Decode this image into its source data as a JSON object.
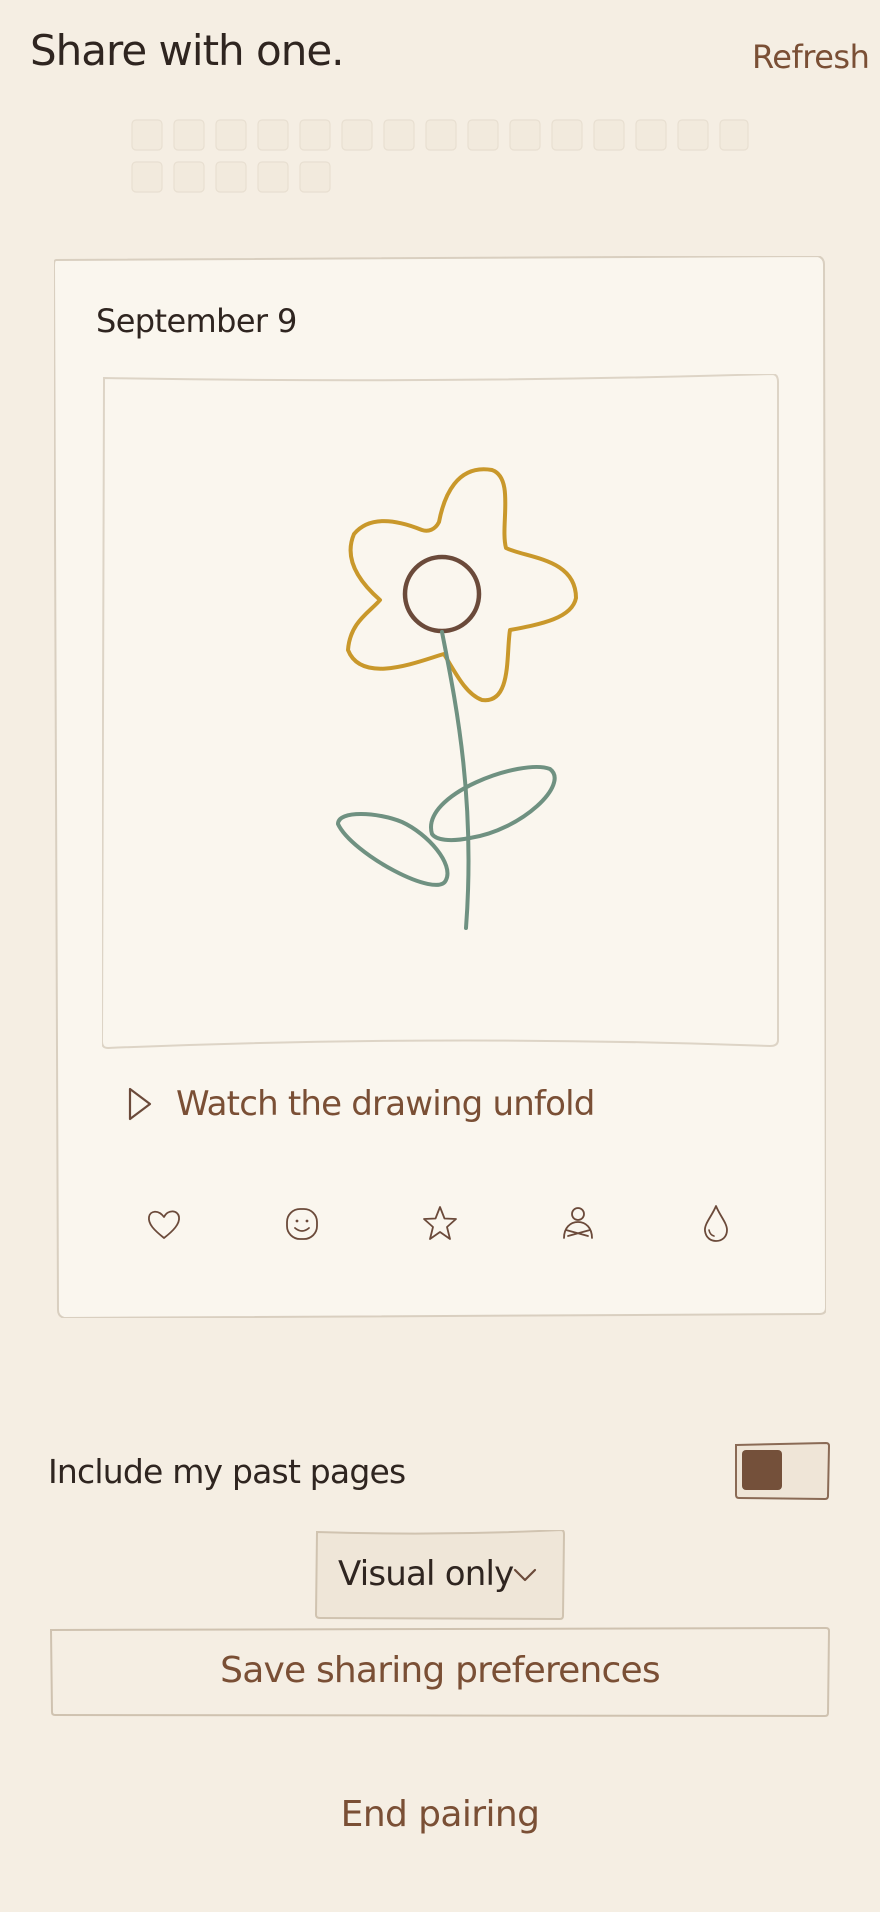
{
  "header": {
    "title": "Share with one.",
    "refresh_label": "Refresh"
  },
  "card": {
    "date": "September 9",
    "watch_label": "Watch the drawing unfold",
    "reactions": [
      "heart-icon",
      "smiley-icon",
      "star-icon",
      "hug-icon",
      "teardrop-icon"
    ]
  },
  "sharing": {
    "past_pages_label": "Include my past pages",
    "past_pages_enabled": false,
    "visibility_selected": "Visual only",
    "save_label": "Save sharing preferences",
    "end_pairing_label": "End pairing"
  },
  "colors": {
    "background": "#f5eee3",
    "card": "#faf6ee",
    "accent_brown": "#7a4f35",
    "text_dark": "#2f2520",
    "petal_yellow": "#c9982b",
    "flower_center": "#6b4a3a",
    "stem_green": "#6f9181"
  }
}
